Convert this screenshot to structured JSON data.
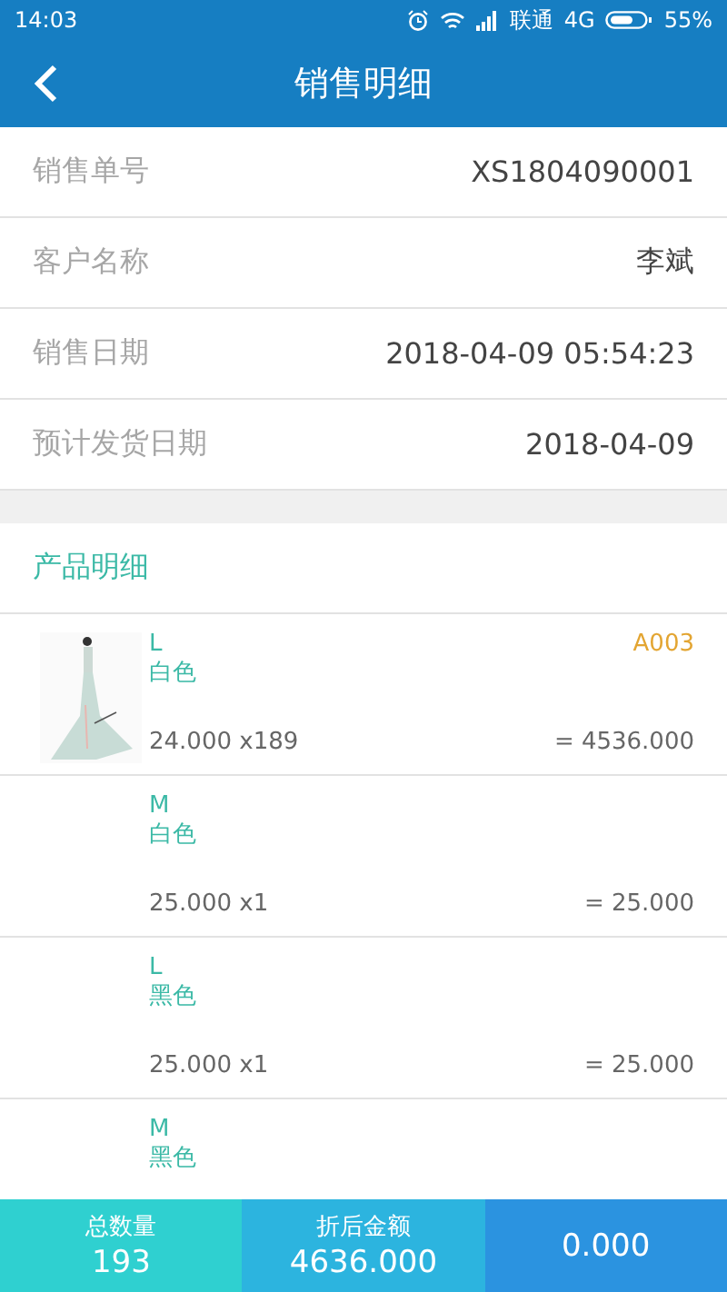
{
  "status_bar": {
    "time": "14:03",
    "carrier": "联通",
    "network": "4G",
    "battery": "55%"
  },
  "header": {
    "title": "销售明细"
  },
  "fields": [
    {
      "label": "销售单号",
      "value": "XS1804090001"
    },
    {
      "label": "客户名称",
      "value": "李斌"
    },
    {
      "label": "销售日期",
      "value": "2018-04-09 05:54:23"
    },
    {
      "label": "预计发货日期",
      "value": "2018-04-09"
    }
  ],
  "products_section": {
    "title": "产品明细"
  },
  "products": [
    {
      "size": "L",
      "color_name": "白色",
      "code": "A003",
      "price_qty": "24.000 x189",
      "amount": "= 4536.000"
    },
    {
      "size": "M",
      "color_name": "白色",
      "price_qty": "25.000 x1",
      "amount": "= 25.000"
    },
    {
      "size": "L",
      "color_name": "黑色",
      "price_qty": "25.000 x1",
      "amount": "= 25.000"
    },
    {
      "size": "M",
      "color_name": "黑色"
    }
  ],
  "summary": [
    {
      "label": "总数量",
      "value": "193",
      "color": "#2fd0d0"
    },
    {
      "label": "折后金额",
      "value": "4636.000",
      "color": "#2cb4df"
    },
    {
      "value": "0.000",
      "color": "#2b93e0"
    }
  ]
}
